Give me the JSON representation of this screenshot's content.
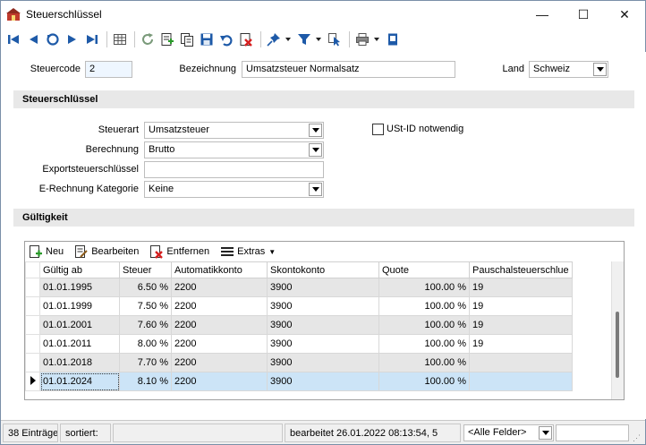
{
  "window": {
    "title": "Steuerschlüssel"
  },
  "titlebar_buttons": {
    "minimize": "—",
    "maximize": "☐",
    "close": "✕"
  },
  "header": {
    "steuercode_label": "Steuercode",
    "steuercode_value": "2",
    "bezeichnung_label": "Bezeichnung",
    "bezeichnung_value": "Umsatzsteuer Normalsatz",
    "land_label": "Land",
    "land_value": "Schweiz"
  },
  "section_steuerschluessel": {
    "title": "Steuerschlüssel"
  },
  "form": {
    "steuerart_label": "Steuerart",
    "steuerart_value": "Umsatzsteuer",
    "berechnung_label": "Berechnung",
    "berechnung_value": "Brutto",
    "export_label": "Exportsteuerschlüssel",
    "export_value": "",
    "erechnung_label": "E-Rechnung Kategorie",
    "erechnung_value": "Keine",
    "ustid_label": "USt-ID notwendig",
    "ustid_checked": false
  },
  "section_gueltigkeit": {
    "title": "Gültigkeit"
  },
  "grid_toolbar": {
    "neu": "Neu",
    "bearbeiten": "Bearbeiten",
    "entfernen": "Entfernen",
    "extras": "Extras"
  },
  "table": {
    "columns": [
      "Gültig ab",
      "Steuer",
      "Automatikkonto",
      "Skontokonto",
      "Quote",
      "Pauschalsteuerschlue"
    ],
    "rows": [
      [
        "01.01.1995",
        "6.50 %",
        "2200",
        "3900",
        "100.00 %",
        "19"
      ],
      [
        "01.01.1999",
        "7.50 %",
        "2200",
        "3900",
        "100.00 %",
        "19"
      ],
      [
        "01.01.2001",
        "7.60 %",
        "2200",
        "3900",
        "100.00 %",
        "19"
      ],
      [
        "01.01.2011",
        "8.00 %",
        "2200",
        "3900",
        "100.00 %",
        "19"
      ],
      [
        "01.01.2018",
        "7.70 %",
        "2200",
        "3900",
        "100.00 %",
        ""
      ],
      [
        "01.01.2024",
        "8.10 %",
        "2200",
        "3900",
        "100.00 %",
        ""
      ]
    ],
    "selected_row": 5
  },
  "status": {
    "count": "38 Einträge",
    "sorted_label": "sortiert:",
    "sorted_value": "",
    "edited": "bearbeitet 26.01.2022 08:13:54,  5",
    "field_filter": "<Alle Felder>",
    "search_value": ""
  },
  "icons": {
    "toolbar": [
      "first-record-icon",
      "prev-record-icon",
      "back-icon",
      "next-record-icon",
      "last-record-icon",
      "table-view-icon",
      "refresh-icon",
      "new-record-icon",
      "copy-icon",
      "save-icon",
      "undo-icon",
      "delete-icon",
      "pin-icon",
      "filter-icon",
      "cursor-select-icon",
      "print-icon",
      "notes-icon"
    ]
  },
  "colors": {
    "accent": "#1e5aa8",
    "selected_row": "#cce4f7",
    "alt_row": "#e6e6e6",
    "section_bg": "#e8e8e8"
  }
}
